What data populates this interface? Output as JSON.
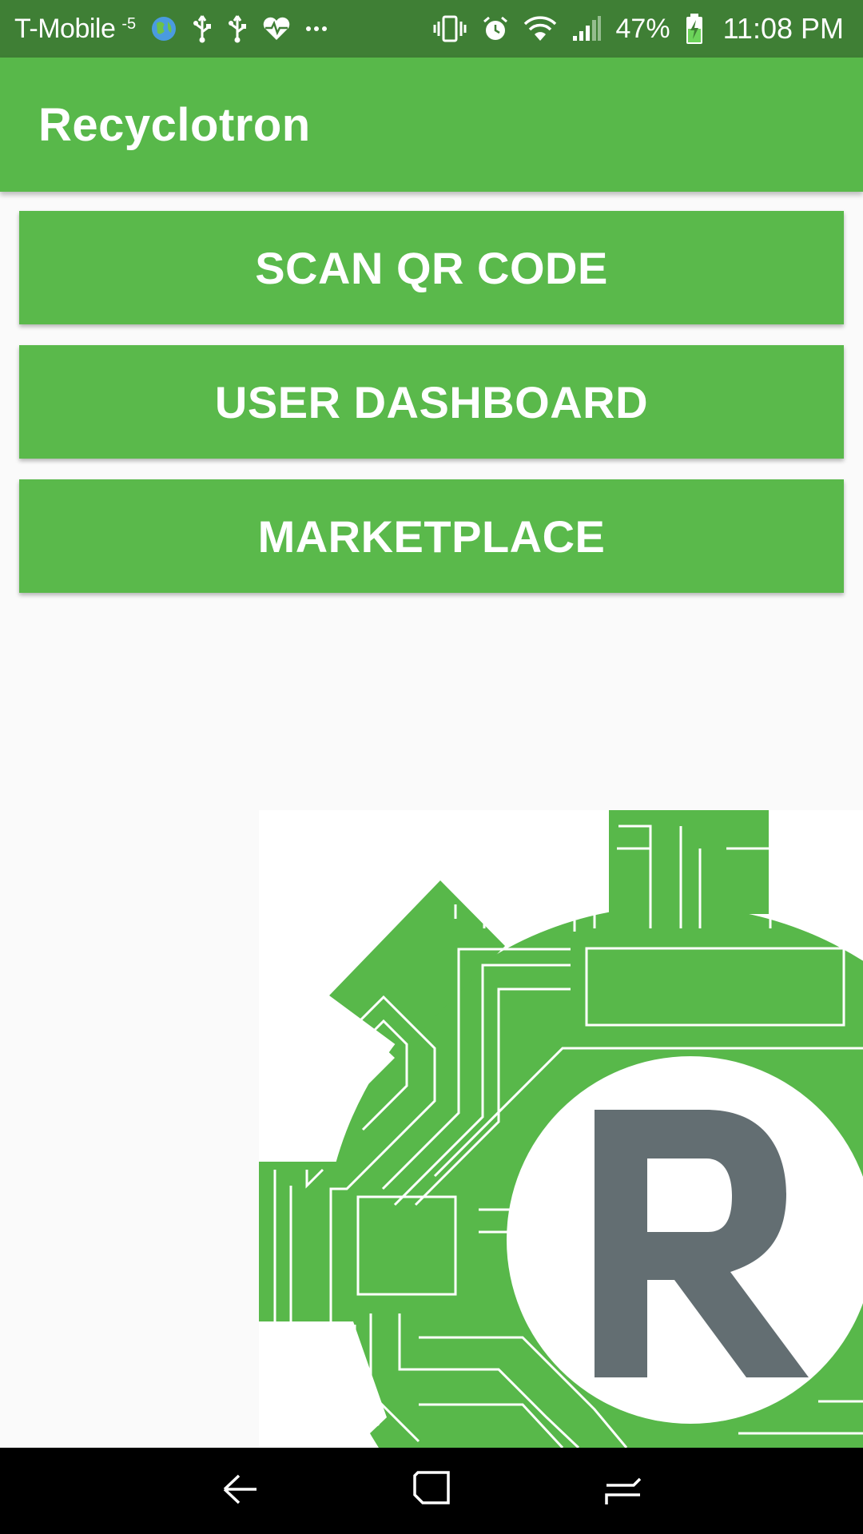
{
  "status_bar": {
    "carrier": "T-Mobile",
    "carrier_extra": "-5",
    "icons_left": [
      "globe-icon",
      "usb-icon",
      "usb-icon",
      "heart-monitor-icon",
      "more-icon"
    ],
    "icons_right": [
      "vibrate-icon",
      "alarm-icon",
      "wifi-icon",
      "signal-icon"
    ],
    "battery_percent": "47%",
    "battery_icon": "battery-charging-icon",
    "time": "11:08 PM"
  },
  "app_bar": {
    "title": "Recyclotron"
  },
  "buttons": [
    {
      "label": "SCAN QR CODE"
    },
    {
      "label": "USER DASHBOARD"
    },
    {
      "label": "MARKETPLACE"
    }
  ],
  "logo": {
    "letter": "R",
    "brand_green": "#58b84a",
    "letter_color": "#636e72"
  },
  "nav_bar": {
    "items": [
      "back-icon",
      "home-icon",
      "recents-icon"
    ]
  },
  "colors": {
    "status_bar": "#3f7f35",
    "primary": "#58b84a",
    "background": "#fafafa"
  }
}
